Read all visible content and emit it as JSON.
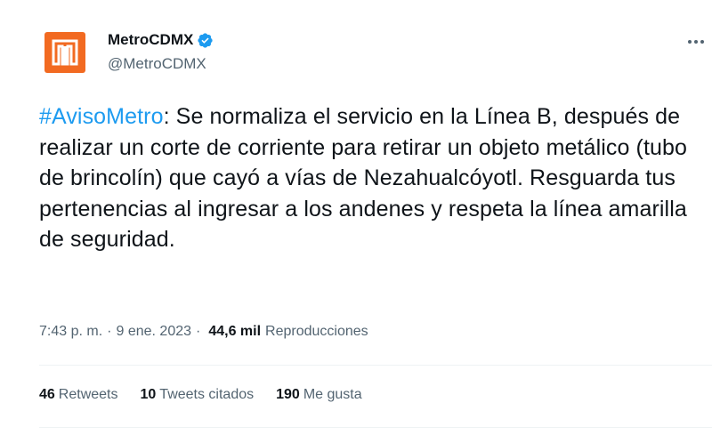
{
  "tweet": {
    "author": {
      "display_name": "MetroCDMX",
      "handle": "@MetroCDMX",
      "verified": true,
      "avatar_icon": "metro-cdmx-logo-icon",
      "avatar_color": "#f26a21",
      "verified_color": "#1d9bf0"
    },
    "more_icon": "more-options-icon",
    "text": {
      "hashtag": "#AvisoMetro",
      "body": ": Se normaliza el servicio en la Línea B, después de realizar un corte de corriente para retirar un objeto metálico (tubo de brincolín) que cayó a vías de Nezahualcóyotl. Resguarda tus pertenencias al ingresar a los andenes y respeta la línea amarilla de seguridad."
    },
    "meta": {
      "time": "7:43 p. m.",
      "separator": "·",
      "date": "9 ene. 2023",
      "views_count": "44,6 mil",
      "views_label": "Reproducciones"
    },
    "stats": {
      "retweets_count": "46",
      "retweets_label": "Retweets",
      "quotes_count": "10",
      "quotes_label": "Tweets citados",
      "likes_count": "190",
      "likes_label": "Me gusta"
    },
    "colors": {
      "link": "#1d9bf0",
      "text": "#0f1419",
      "secondary": "#536471"
    }
  }
}
